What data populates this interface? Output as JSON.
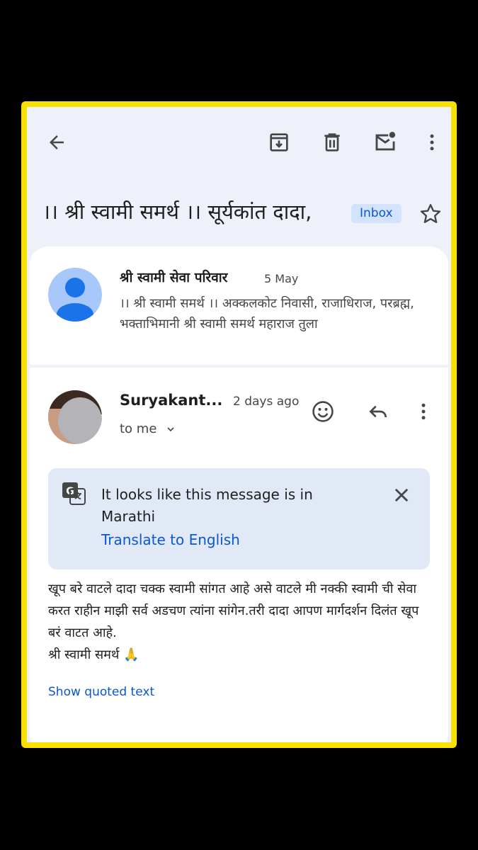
{
  "subject": "।। श्री स्वामी समर्थ ।। सूर्यकांत दादा,",
  "label": "Inbox",
  "toolbar": {
    "icons": [
      "back-arrow-icon",
      "archive-icon",
      "delete-icon",
      "mark-unread-icon",
      "more-vert-icon"
    ]
  },
  "thread": {
    "collapsed": {
      "sender": "श्री स्वामी सेवा परिवार",
      "date": "5 May",
      "snippet": "।। श्री स्वामी समर्थ ।। अक्कलकोट निवासी, राजाधिराज, परब्रह्म, भक्ताभिमानी श्री स्वामी समर्थ महाराज तुला"
    },
    "expanded": {
      "sender": "Suryakant...",
      "time": "2 days ago",
      "to": "to me",
      "translate": {
        "message": "It looks like this message is in Marathi",
        "link": "Translate to English"
      },
      "body": "खूप बरे वाटले दादा चक्क स्वामी सांगत आहे असे वाटले मी नक्की स्वामी ची सेवा करत राहीन माझी सर्व अडचण त्यांना सांगेन.तरी दादा आपण मार्गदर्शन दिलंत खूप बरं वाटत आहे.\nश्री स्वामी समर्थ 🙏",
      "show_quoted": "Show quoted text"
    }
  },
  "colors": {
    "background": "#eef1f9",
    "frame_highlight": "#f8e000",
    "accent": "#0b57d0",
    "chip_bg": "#d3e3fd",
    "translate_bg": "#e1e9f7"
  }
}
